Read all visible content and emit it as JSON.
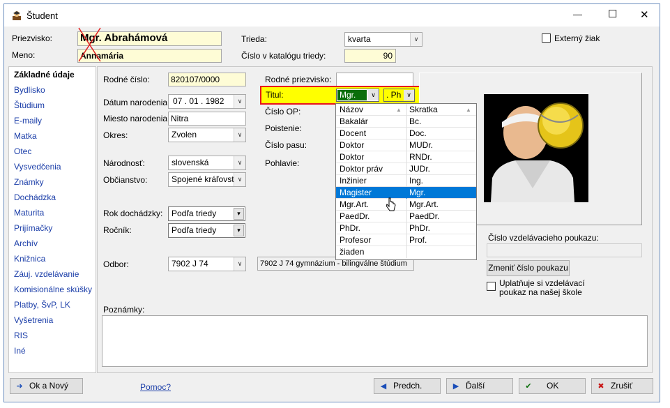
{
  "window": {
    "title": "Študent",
    "minimize": "—",
    "maximize": "☐",
    "close": "✕"
  },
  "header": {
    "priezvisko_label": "Priezvisko:",
    "priezvisko_value": "Mgr. Abrahámová",
    "meno_label": "Meno:",
    "meno_value": "Annamária",
    "trieda_label": "Trieda:",
    "trieda_value": "kvarta",
    "katalog_label": "Číslo v katalógu triedy:",
    "katalog_value": "90",
    "externy_label": "Externý žiak"
  },
  "sidebar": {
    "items": [
      {
        "label": "Základné údaje"
      },
      {
        "label": "Bydlisko"
      },
      {
        "label": "Štúdium"
      },
      {
        "label": "E-maily"
      },
      {
        "label": "Matka"
      },
      {
        "label": "Otec"
      },
      {
        "label": "Vysvedčenia"
      },
      {
        "label": "Známky"
      },
      {
        "label": "Dochádzka"
      },
      {
        "label": "Maturita"
      },
      {
        "label": "Prijímačky"
      },
      {
        "label": "Archív"
      },
      {
        "label": "Knižnica"
      },
      {
        "label": "Záuj. vzdelávanie"
      },
      {
        "label": "Komisionálne skúšky"
      },
      {
        "label": "Platby, ŠvP, LK"
      },
      {
        "label": "Vyšetrenia"
      },
      {
        "label": "RIS"
      },
      {
        "label": "Iné"
      }
    ]
  },
  "form": {
    "rodne_cislo_label": "Rodné číslo:",
    "rodne_cislo_value": "820107/0000",
    "datum_label": "Dátum narodenia:",
    "datum_value": "07 . 01 . 1982",
    "miesto_label": "Miesto narodenia:",
    "miesto_value": "Nitra",
    "okres_label": "Okres:",
    "okres_value": "Zvolen",
    "narodnost_label": "Národnosť:",
    "narodnost_value": "slovenská",
    "obcianstvo_label": "Občianstvo:",
    "obcianstvo_value": "Spojené kráľovstvo",
    "rok_label": "Rok dochádzky:",
    "rok_value": "Podľa triedy",
    "rocnik_label": "Ročník:",
    "rocnik_value": "Podľa triedy",
    "odbor_label": "Odbor:",
    "odbor_value": "7902 J 74",
    "odbor_desc": "7902 J 74 gymnázium - bilingválne štúdium",
    "rodne_priezvisko_label": "Rodné priezvisko:",
    "titul_label": "Titul:",
    "titul_value": "Mgr.",
    "titul2_value": ". Ph",
    "cislo_op_label": "Číslo OP:",
    "poistenie_label": "Poistenie:",
    "cislo_pasu_label": "Číslo pasu:",
    "pohlavie_label": "Pohlavie:",
    "poznamky_label": "Poznámky:"
  },
  "dropdown": {
    "headers": {
      "name": "Názov",
      "short": "Skratka"
    },
    "selected": "Magister",
    "rows": [
      {
        "name": "Bakalár",
        "short": "Bc."
      },
      {
        "name": "Docent",
        "short": "Doc."
      },
      {
        "name": "Doktor",
        "short": "MUDr."
      },
      {
        "name": "Doktor",
        "short": "RNDr."
      },
      {
        "name": "Doktor práv",
        "short": "JUDr."
      },
      {
        "name": "Inžinier",
        "short": "Ing."
      },
      {
        "name": "Magister",
        "short": "Mgr."
      },
      {
        "name": "Mgr.Art.",
        "short": "Mgr.Art."
      },
      {
        "name": "PaedDr.",
        "short": "PaedDr."
      },
      {
        "name": "PhDr.",
        "short": "PhDr."
      },
      {
        "name": "Profesor",
        "short": "Prof."
      },
      {
        "name": "žiaden",
        "short": ""
      }
    ]
  },
  "voucher": {
    "label": "Číslo vzdelávacieho poukazu:",
    "change_button": "Zmeniť číslo poukazu",
    "checkbox_label": "Uplatňuje si vzdelávací poukaz na našej škole"
  },
  "footer": {
    "ok_new": "Ok a Nový",
    "help": "Pomoc?",
    "prev": "Predch.",
    "next": "Ďalší",
    "ok": "OK",
    "cancel": "Zrušiť"
  },
  "colors": {
    "highlight_border": "#e8141c",
    "highlight_fill": "#ffff00",
    "selection": "#0078d7",
    "yellow_field": "#fefcd6"
  },
  "icons": [
    "app-icon",
    "user-photo-icon",
    "ok-new-icon",
    "prev-icon",
    "next-icon",
    "ok-icon",
    "cancel-icon"
  ]
}
